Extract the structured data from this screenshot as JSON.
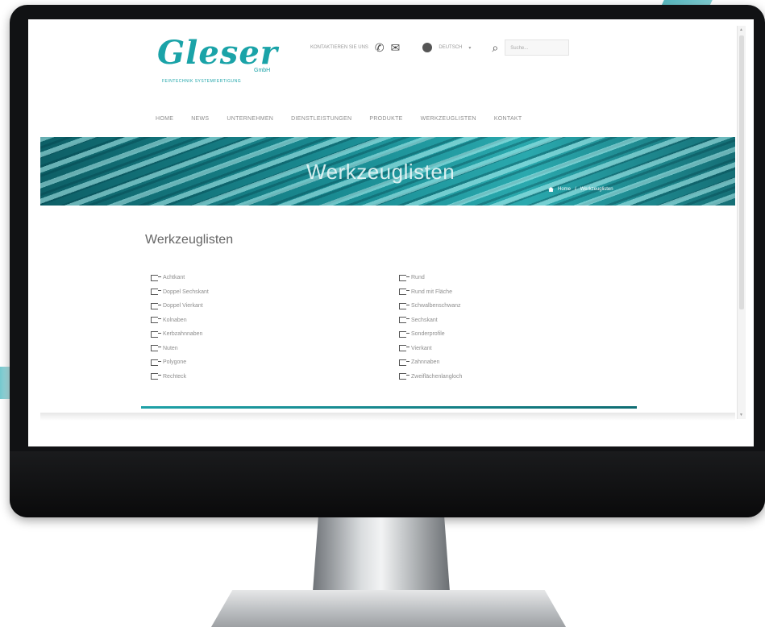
{
  "header": {
    "logo_text": "Gleser",
    "logo_gmbh": "GmbH",
    "logo_tagline": "FEINTECHNIK SYSTEMFERTIGUNG",
    "contact_label": "KONTAKTIEREN SIE UNS",
    "language_label": "DEUTSCH",
    "search_placeholder": "Suche..."
  },
  "icons": {
    "phone": "phone-icon",
    "mail": "mail-icon",
    "globe": "globe-icon",
    "search": "search-icon",
    "home": "home-icon",
    "list_item": "external-link-icon"
  },
  "nav": {
    "items": [
      "HOME",
      "NEWS",
      "UNTERNEHMEN",
      "DIENSTLEISTUNGEN",
      "PRODUKTE",
      "WERKZEUGLISTEN",
      "KONTAKT"
    ]
  },
  "banner": {
    "title": "Werkzeuglisten",
    "breadcrumb": [
      "Home",
      "/",
      "Werkzeuglisten"
    ]
  },
  "main": {
    "title": "Werkzeuglisten",
    "left_list": [
      "Achtkant",
      "Doppel Sechskant",
      "Doppel Vierkant",
      "Kolnaben",
      "Kerbzahnnaben",
      "Nuten",
      "Polygone",
      "Rechteck"
    ],
    "right_list": [
      "Rund",
      "Rund mit Fläche",
      "Schwalbenschwanz",
      "Sechskant",
      "Sonderprofile",
      "Vierkant",
      "Zahnnaben",
      "Zweiflächenlangloch"
    ]
  },
  "colors": {
    "accent": "#1aa3a8",
    "monitor": "#111214"
  }
}
